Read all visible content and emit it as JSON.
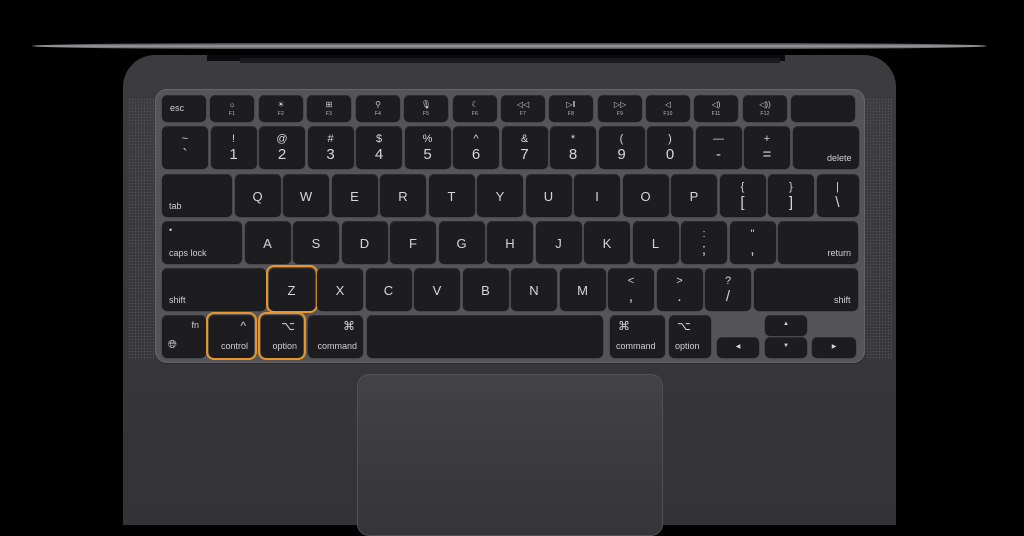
{
  "scene": "MacBook keyboard top-down view with highlighted keys",
  "highlight_color": "#e8962c",
  "highlighted_keys": [
    "control",
    "option",
    "Z"
  ],
  "rows": {
    "function": [
      {
        "id": "esc",
        "label": "esc"
      },
      {
        "id": "f1",
        "icon": "☼",
        "fn": "F1",
        "icon_name": "brightness-down-icon"
      },
      {
        "id": "f2",
        "icon": "☀",
        "fn": "F2",
        "icon_name": "brightness-up-icon"
      },
      {
        "id": "f3",
        "icon": "⊞",
        "fn": "F3",
        "icon_name": "mission-control-icon"
      },
      {
        "id": "f4",
        "icon": "⚲",
        "fn": "F4",
        "icon_name": "spotlight-search-icon"
      },
      {
        "id": "f5",
        "icon": "🎙︎",
        "fn": "F5",
        "icon_name": "dictation-icon"
      },
      {
        "id": "f6",
        "icon": "☾",
        "fn": "F6",
        "icon_name": "do-not-disturb-icon"
      },
      {
        "id": "f7",
        "icon": "◁◁",
        "fn": "F7",
        "icon_name": "rewind-icon"
      },
      {
        "id": "f8",
        "icon": "▷‖",
        "fn": "F8",
        "icon_name": "play-pause-icon"
      },
      {
        "id": "f9",
        "icon": "▷▷",
        "fn": "F9",
        "icon_name": "fast-forward-icon"
      },
      {
        "id": "f10",
        "icon": "◁",
        "fn": "F10",
        "icon_name": "mute-icon"
      },
      {
        "id": "f11",
        "icon": "◁)",
        "fn": "F11",
        "icon_name": "volume-down-icon"
      },
      {
        "id": "f12",
        "icon": "◁))",
        "fn": "F12",
        "icon_name": "volume-up-icon"
      },
      {
        "id": "touchid",
        "label": "",
        "icon_name": "touch-id-icon"
      }
    ],
    "number": [
      {
        "top": "~",
        "bot": "`"
      },
      {
        "top": "!",
        "bot": "1"
      },
      {
        "top": "@",
        "bot": "2"
      },
      {
        "top": "#",
        "bot": "3"
      },
      {
        "top": "$",
        "bot": "4"
      },
      {
        "top": "%",
        "bot": "5"
      },
      {
        "top": "^",
        "bot": "6"
      },
      {
        "top": "&",
        "bot": "7"
      },
      {
        "top": "*",
        "bot": "8"
      },
      {
        "top": "(",
        "bot": "9"
      },
      {
        "top": ")",
        "bot": "0"
      },
      {
        "top": "—",
        "bot": "-"
      },
      {
        "top": "+",
        "bot": "="
      },
      {
        "label": "delete"
      }
    ],
    "qwerty": [
      {
        "label": "tab"
      },
      {
        "letter": "Q"
      },
      {
        "letter": "W"
      },
      {
        "letter": "E"
      },
      {
        "letter": "R"
      },
      {
        "letter": "T"
      },
      {
        "letter": "Y"
      },
      {
        "letter": "U"
      },
      {
        "letter": "I"
      },
      {
        "letter": "O"
      },
      {
        "letter": "P"
      },
      {
        "top": "{",
        "bot": "["
      },
      {
        "top": "}",
        "bot": "]"
      },
      {
        "top": "|",
        "bot": "\\"
      }
    ],
    "home": [
      {
        "label": "caps lock",
        "dot": "•"
      },
      {
        "letter": "A"
      },
      {
        "letter": "S"
      },
      {
        "letter": "D"
      },
      {
        "letter": "F"
      },
      {
        "letter": "G"
      },
      {
        "letter": "H"
      },
      {
        "letter": "J"
      },
      {
        "letter": "K"
      },
      {
        "letter": "L"
      },
      {
        "top": ":",
        "bot": ";"
      },
      {
        "top": "\"",
        "bot": ","
      },
      {
        "label": "return"
      }
    ],
    "shift": [
      {
        "label": "shift"
      },
      {
        "letter": "Z"
      },
      {
        "letter": "X"
      },
      {
        "letter": "C"
      },
      {
        "letter": "V"
      },
      {
        "letter": "B"
      },
      {
        "letter": "N"
      },
      {
        "letter": "M"
      },
      {
        "top": "<",
        "bot": ","
      },
      {
        "top": ">",
        "bot": "."
      },
      {
        "top": "?",
        "bot": "/"
      },
      {
        "label": "shift"
      }
    ],
    "bottom": [
      {
        "label": "fn",
        "icon": "🌐︎",
        "icon_name": "globe-icon"
      },
      {
        "label": "control",
        "icon": "^",
        "icon_name": "control-icon"
      },
      {
        "label": "option",
        "icon": "⌥",
        "icon_name": "option-icon"
      },
      {
        "label": "command",
        "icon": "⌘",
        "icon_name": "command-icon"
      },
      {
        "label": ""
      },
      {
        "label": "command",
        "icon": "⌘",
        "icon_name": "command-icon"
      },
      {
        "label": "option",
        "icon": "⌥",
        "icon_name": "option-icon"
      }
    ],
    "arrows": {
      "left": "◀",
      "up": "▲",
      "down": "▼",
      "right": "▶"
    }
  }
}
